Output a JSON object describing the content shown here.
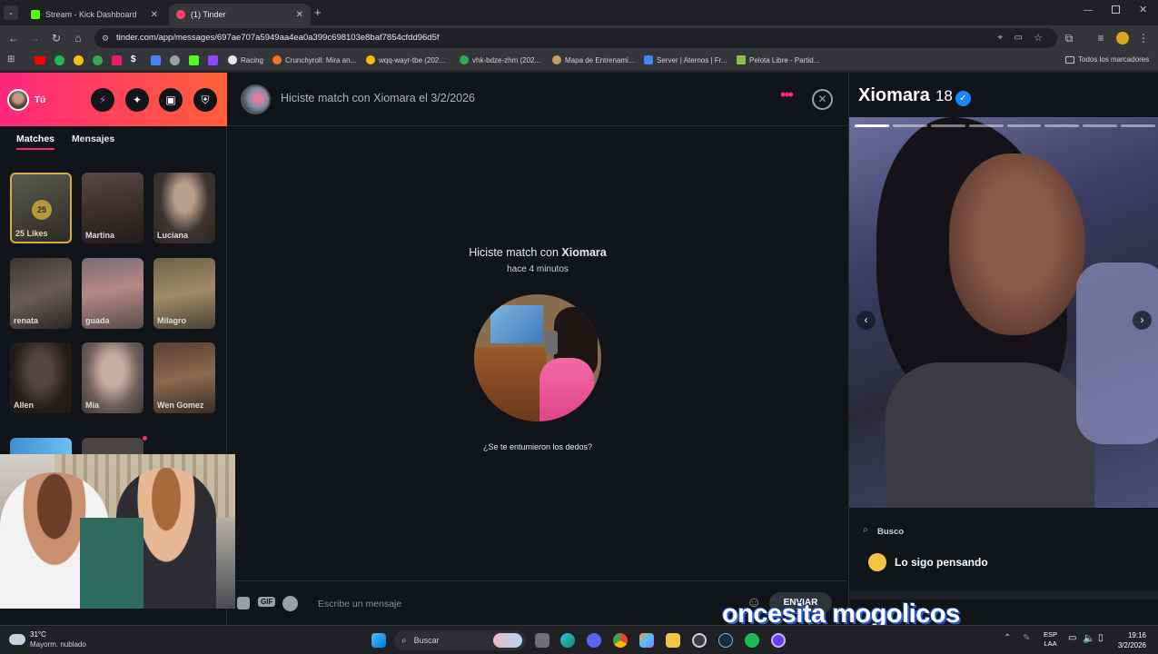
{
  "browser": {
    "tabs": [
      {
        "title": "Stream - Kick Dashboard",
        "color": "#53fc18"
      },
      {
        "title": "(1) Tinder",
        "color": "#fe3c72"
      }
    ],
    "url": "tinder.com/app/messages/697ae707a5949aa4ea0a399c698103e8baf7854cfdd96d5f",
    "bookmarks": [
      {
        "label": "Racing",
        "color": "#e8eaed"
      },
      {
        "label": "Crunchyroll: Mira an...",
        "color": "#f47521"
      },
      {
        "label": "wqq-wayr-tbe (202...",
        "color": "#fbbc04"
      },
      {
        "label": "vhk-bdze-zhm (202...",
        "color": "#34a853"
      },
      {
        "label": "Mapa de Entrenami...",
        "color": "#c69c6d"
      },
      {
        "label": "Server | Aternos | Fr...",
        "color": "#4285f4"
      },
      {
        "label": "Pelota Libre - Partid...",
        "color": "#8bc34a"
      }
    ],
    "all_bookmarks": "Todos los marcadores"
  },
  "sidebar": {
    "user_label": "Tú",
    "tabs": {
      "matches": "Matches",
      "messages": "Mensajes"
    },
    "likes": {
      "count": "25",
      "label": "25 Likes"
    },
    "matches": [
      {
        "name": "Martina"
      },
      {
        "name": "Luciana"
      },
      {
        "name": "renata"
      },
      {
        "name": "guada"
      },
      {
        "name": "Milagro"
      },
      {
        "name": "Allen"
      },
      {
        "name": "Mia"
      },
      {
        "name": "Wen Gomez"
      }
    ]
  },
  "conversation": {
    "header_text": "Hiciste match con Xiomara el 3/2/2026",
    "match_title_prefix": "Hiciste match con",
    "match_name": "Xiomara",
    "match_time": "hace 4 minutos",
    "prompt": "¿Se te entumieron los dedos?",
    "composer_placeholder": "Escribe un mensaje",
    "send_label": "ENVIAR",
    "gif_label": "GIF"
  },
  "profile": {
    "name": "Xiomara",
    "age": "18",
    "photo_count": 8,
    "active_photo": 1,
    "looking_for_label": "Busco",
    "looking_for_value": "Lo sigo pensando"
  },
  "overlay": {
    "text": "oncesita mogolicos"
  },
  "taskbar": {
    "weather_temp": "31°C",
    "weather_desc": "Mayorm. nublado",
    "search_placeholder": "Buscar",
    "lang": "ESP",
    "lang2": "LAA",
    "time": "19:16",
    "date": "3/2/2026"
  },
  "colors": {
    "tinder_pink": "#fd267d",
    "tinder_orange": "#ff6036",
    "verified": "#1786ff",
    "send_bg": "#2f333a"
  }
}
